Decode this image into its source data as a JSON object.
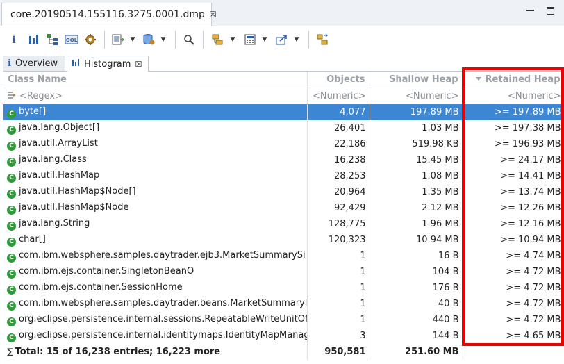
{
  "editor": {
    "tab_title": "core.20190514.155116.3275.0001.dmp",
    "tab_close": "☒"
  },
  "toolbar": {
    "icons": [
      "info-icon",
      "histogram-icon",
      "dominator-tree-icon",
      "oql-icon",
      "gear-icon",
      "heapdump-overview-icon",
      "query-browser-icon",
      "search-icon",
      "group-icon",
      "calculator-icon",
      "export-icon",
      "compare-icon"
    ]
  },
  "view_tabs": [
    {
      "label": "Overview",
      "icon": "i"
    },
    {
      "label": "Histogram",
      "icon": "histogram",
      "close": "☒"
    }
  ],
  "table": {
    "headers": {
      "class_name": "Class Name",
      "objects": "Objects",
      "shallow_heap": "Shallow Heap",
      "retained_heap": "Retained Heap"
    },
    "filter": {
      "class_name": "<Regex>",
      "objects": "<Numeric>",
      "shallow_heap": "<Numeric>",
      "retained_heap": "<Numeric>"
    },
    "rows": [
      {
        "name": "byte[]",
        "objects": "4,077",
        "shallow": "197.89 MB",
        "retained": ">= 197.89 MB"
      },
      {
        "name": "java.lang.Object[]",
        "objects": "26,401",
        "shallow": "1.03 MB",
        "retained": ">= 197.38 MB"
      },
      {
        "name": "java.util.ArrayList",
        "objects": "22,186",
        "shallow": "519.98 KB",
        "retained": ">= 196.93 MB"
      },
      {
        "name": "java.lang.Class",
        "objects": "16,238",
        "shallow": "15.45 MB",
        "retained": ">= 24.17 MB"
      },
      {
        "name": "java.util.HashMap",
        "objects": "28,253",
        "shallow": "1.08 MB",
        "retained": ">= 14.41 MB"
      },
      {
        "name": "java.util.HashMap$Node[]",
        "objects": "20,964",
        "shallow": "1.35 MB",
        "retained": ">= 13.74 MB"
      },
      {
        "name": "java.util.HashMap$Node",
        "objects": "92,429",
        "shallow": "2.12 MB",
        "retained": ">= 12.26 MB"
      },
      {
        "name": "java.lang.String",
        "objects": "128,775",
        "shallow": "1.96 MB",
        "retained": ">= 12.16 MB"
      },
      {
        "name": "char[]",
        "objects": "120,323",
        "shallow": "10.94 MB",
        "retained": ">= 10.94 MB"
      },
      {
        "name": "com.ibm.websphere.samples.daytrader.ejb3.MarketSummarySi",
        "objects": "1",
        "shallow": "16 B",
        "retained": ">= 4.74 MB"
      },
      {
        "name": "com.ibm.ejs.container.SingletonBeanO",
        "objects": "1",
        "shallow": "104 B",
        "retained": ">= 4.72 MB"
      },
      {
        "name": "com.ibm.ejs.container.SessionHome",
        "objects": "1",
        "shallow": "176 B",
        "retained": ">= 4.72 MB"
      },
      {
        "name": "com.ibm.websphere.samples.daytrader.beans.MarketSummaryl",
        "objects": "1",
        "shallow": "40 B",
        "retained": ">= 4.72 MB"
      },
      {
        "name": "org.eclipse.persistence.internal.sessions.RepeatableWriteUnitOf",
        "objects": "1",
        "shallow": "440 B",
        "retained": ">= 4.72 MB"
      },
      {
        "name": "org.eclipse.persistence.internal.identitymaps.IdentityMapManag",
        "objects": "3",
        "shallow": "144 B",
        "retained": ">= 4.65 MB"
      }
    ],
    "total": {
      "label": "Total: 15 of 16,238 entries; 16,223 more",
      "objects": "950,581",
      "shallow": "251.60 MB",
      "retained": ""
    }
  },
  "colors": {
    "selection": "#3d86d3",
    "highlight_border": "#ee0000",
    "class_icon": "#2e9b3a"
  }
}
